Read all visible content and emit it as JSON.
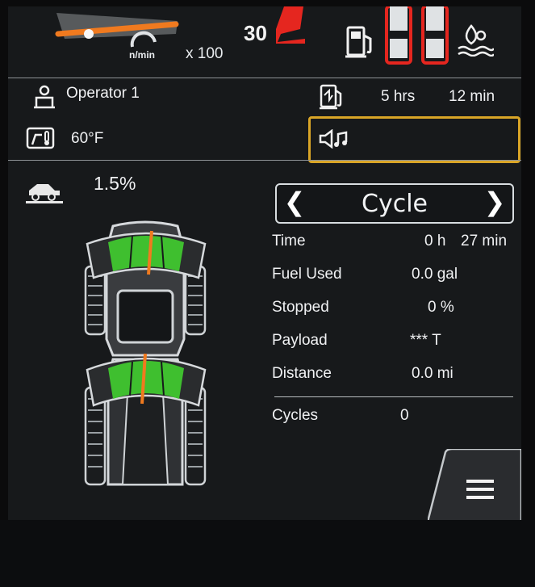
{
  "top_gauge": {
    "rpm_unit": "n/min",
    "rpm_multiplier": "x 100",
    "speed_value": "30"
  },
  "status": {
    "operator_label": "Operator 1",
    "temperature": "60°F",
    "fuel_time_hours": "5 hrs",
    "fuel_time_minutes": "12 min"
  },
  "incline": {
    "value": "1.5%"
  },
  "cycle_panel": {
    "title": "Cycle",
    "rows": [
      {
        "label": "Time",
        "value_a": "0 h",
        "value_b": "27 min"
      },
      {
        "label": "Fuel Used",
        "value_a": "0.0 gal",
        "value_b": ""
      },
      {
        "label": "Stopped",
        "value_a": "0 %",
        "value_b": ""
      },
      {
        "label": "Payload",
        "value_a": "*** T",
        "value_b": ""
      },
      {
        "label": "Distance",
        "value_a": "0.0 mi",
        "value_b": ""
      }
    ],
    "cycles_label": "Cycles",
    "cycles_value": "0"
  },
  "colors": {
    "accent_yellow": "#d9a527",
    "gauge_green": "#3fbf2f",
    "gauge_orange": "#f07a1f",
    "alert_red": "#e5261f"
  },
  "icons": [
    "operator-icon",
    "cab-temperature-icon",
    "fuel-pump-icon",
    "fuel-time-icon",
    "audio-icon",
    "truck-incline-icon",
    "cooling-temperature-icon",
    "menu-icon"
  ]
}
